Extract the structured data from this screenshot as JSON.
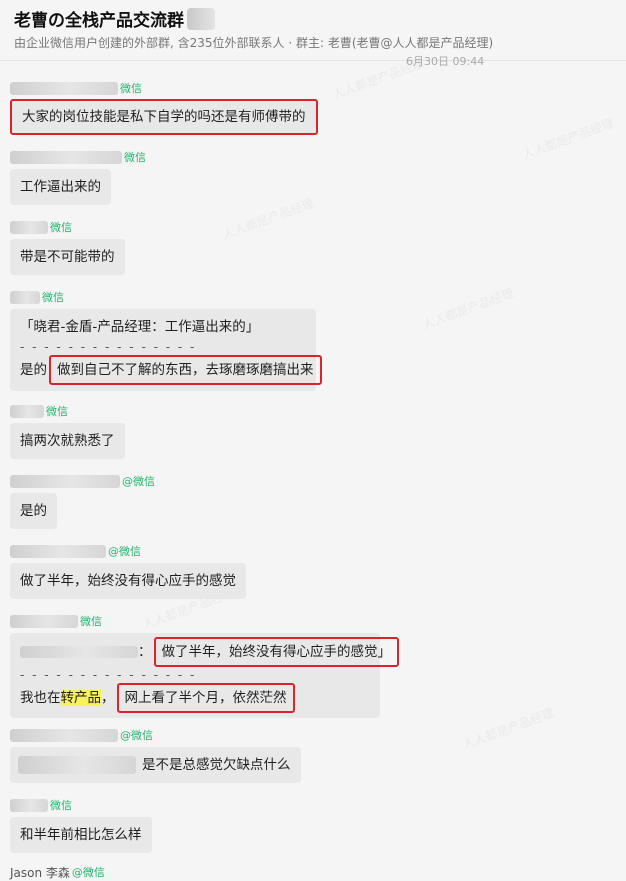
{
  "header": {
    "title": "老曹の全栈产品交流群",
    "subtitle": "由企业微信用户创建的外部群, 含235位外部联系人 · 群主: 老曹(老曹@人人都是产品经理)",
    "time_fragment": "6月30日 09:44"
  },
  "messages": [
    {
      "tag": "微信",
      "text": "大家的岗位技能是私下自学的吗还是有师傅带的"
    },
    {
      "tag": "微信",
      "text": "工作逼出来的"
    },
    {
      "tag": "微信",
      "text": "带是不可能带的"
    },
    {
      "tag": "微信",
      "quote": "「晓君-金盾-产品经理：工作逼出来的」",
      "divider": "- - - - - - - - - - - - - - -",
      "reply_prefix": "是的",
      "reply_boxed": "做到自己不了解的东西，去琢磨琢磨搞出来"
    },
    {
      "tag": "微信",
      "text": "搞两次就熟悉了"
    },
    {
      "tag": "@微信",
      "text": "是的"
    },
    {
      "tag": "@微信",
      "text": "做了半年，始终没有得心应手的感觉"
    },
    {
      "tag": "微信",
      "quote_sep": "：",
      "quote_boxed": "做了半年，始终没有得心应手的感觉」",
      "divider": "- - - - - - - - - - - - - - -",
      "reply_prefix": "我也在",
      "reply_highlight": "转产品",
      "reply_comma": "，",
      "reply_boxed": "网上看了半个月，依然茫然"
    },
    {
      "tag": "@微信",
      "text": "是不是总感觉欠缺点什么"
    },
    {
      "tag": "微信",
      "text": "和半年前相比怎么样"
    },
    {
      "sender_visible": "Jason 李森",
      "tag": "@微信"
    }
  ]
}
